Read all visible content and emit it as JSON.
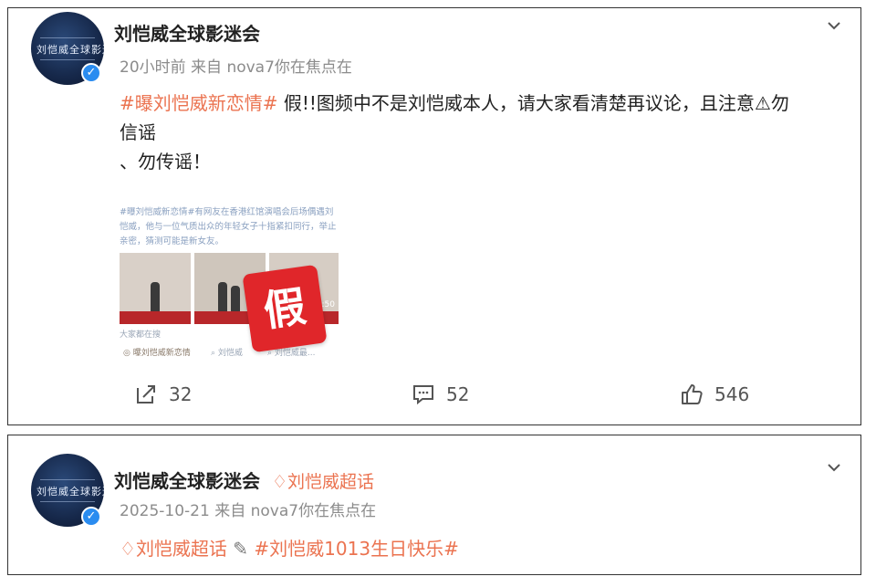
{
  "post1": {
    "avatar_text": "刘恺威全球影迷会",
    "username": "刘恺威全球影迷会",
    "meta": "20小时前  来自 nova7你在焦点在",
    "hashtag": "#曝刘恺威新恋情#",
    "body_line1": " 假!!图频中不是刘恺威本人，请大家看清楚再议论，且注意⚠勿",
    "body_line2": "信谣",
    "body_line3": "、勿传谣！",
    "thumbnail": {
      "caption": "#曝刘恺威新恋情#有网友在香港红馆演唱会后场偶遇刘恺威，他与一位气质出众的年轻女子十指紧扣同行，举止亲密，猜测可能是新女友。",
      "watch_label": "大家都在搜",
      "tags": [
        "曝刘恺威新恋情",
        "刘恺威",
        "刘恺威最..."
      ],
      "duration": "00:50",
      "fake_stamp": "假"
    },
    "actions": {
      "repost_count": "32",
      "comment_count": "52",
      "like_count": "546"
    }
  },
  "post2": {
    "avatar_text": "刘恺威全球影迷会",
    "username": "刘恺威全球影迷会",
    "super_topic": "刘恺威超话",
    "meta": "2025-10-21  来自 nova7你在焦点在",
    "super_topic_link": "刘恺威超话",
    "hashtag": "#刘恺威1013生日快乐#"
  },
  "colors": {
    "accent": "#eb7350",
    "verified": "#2a8cf0",
    "fake_red": "#e0262a"
  }
}
